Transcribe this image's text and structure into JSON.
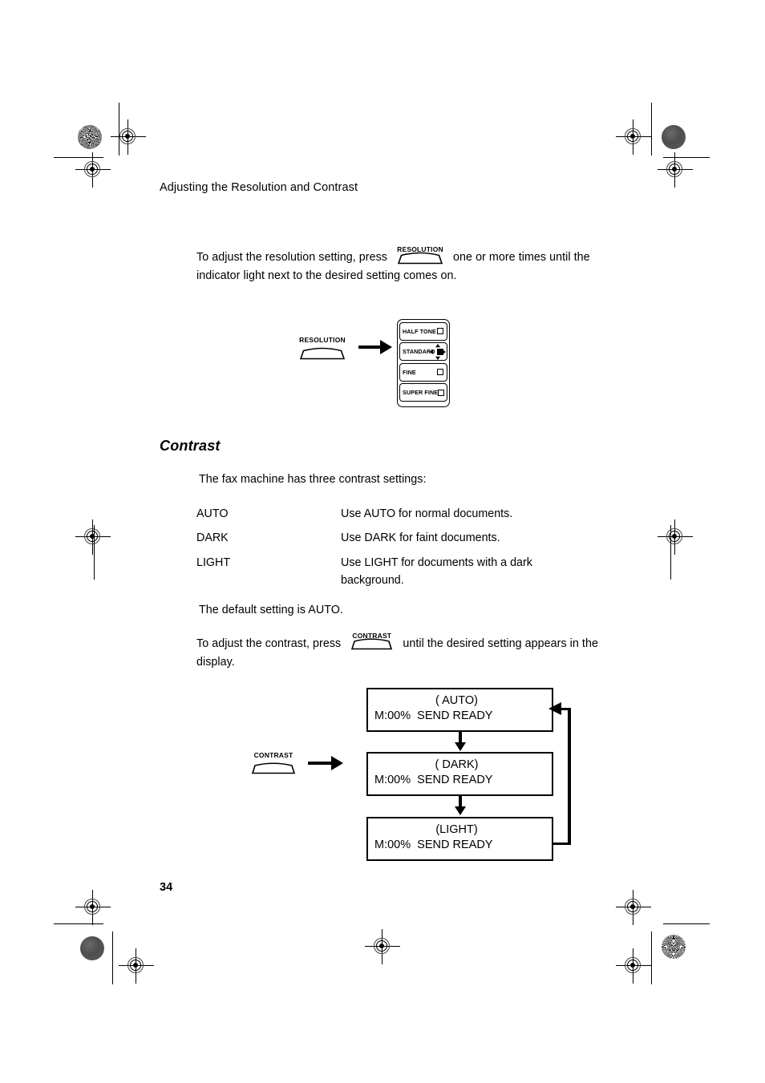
{
  "document": {
    "running_head": "Adjusting the Resolution and Contrast",
    "page_number": "34"
  },
  "resolution_section": {
    "paragraph_before_key": "To adjust the resolution setting, press",
    "key_label": "RESOLUTION",
    "paragraph_after_key": "one or more times until the",
    "paragraph_line2": "indicator light next to the desired setting comes on.",
    "diagram": {
      "key_label": "RESOLUTION",
      "arrow": "right-arrow",
      "panel_rows": [
        {
          "label": "HALF TONE",
          "lit": "false"
        },
        {
          "label": "STANDARD",
          "lit": "true"
        },
        {
          "label": "FINE",
          "lit": "false"
        },
        {
          "label": "SUPER FINE",
          "lit": "false"
        }
      ]
    }
  },
  "contrast_section": {
    "heading": "Contrast",
    "intro": "The fax machine has three contrast settings:",
    "settings": [
      {
        "name": "AUTO",
        "description": "Use AUTO for normal documents."
      },
      {
        "name": "DARK",
        "description": "Use DARK for faint documents."
      },
      {
        "name": "LIGHT",
        "description": "Use LIGHT for documents with a dark\nbackground."
      }
    ],
    "default_note": "The default setting is AUTO.",
    "instruction_before_key": "To adjust the contrast, press",
    "key_label": "CONTRAST",
    "instruction_after_key": "until the desired setting appears in the",
    "instruction_line2": "display.",
    "diagram": {
      "key_label": "CONTRAST",
      "arrow": "right-arrow",
      "screens": [
        {
          "line1": "( AUTO)",
          "line2": "M:00%  SEND READY"
        },
        {
          "line1": "( DARK)",
          "line2": "M:00%  SEND READY"
        },
        {
          "line1": "(LIGHT)",
          "line2": "M:00%  SEND READY"
        }
      ],
      "loop_note": "wrap-around from LIGHT back to AUTO"
    }
  },
  "print_marks": {
    "registration_target": "registration-target",
    "halftone_patch": "halftone-patch",
    "trim_line": "trim-line"
  }
}
